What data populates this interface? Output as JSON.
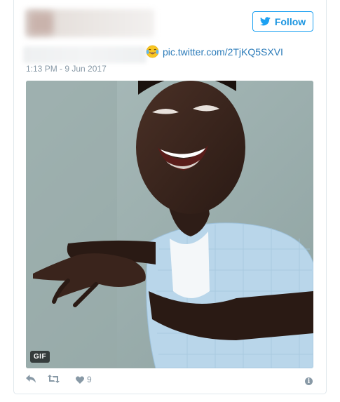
{
  "header": {
    "follow_label": "Follow",
    "follow_icon": "twitter-bird-icon",
    "accent_color": "#1da1f2"
  },
  "tweet": {
    "emoji": "face-with-tears-of-joy",
    "link_text": "pic.twitter.com/2TjKQ5SXVI",
    "timestamp": "1:13 PM - 9 Jun 2017"
  },
  "media": {
    "badge_label": "GIF"
  },
  "actions": {
    "reply_icon": "reply-icon",
    "retweet_icon": "retweet-icon",
    "like_icon": "heart-icon",
    "like_count": "9",
    "info_icon": "info-icon"
  }
}
